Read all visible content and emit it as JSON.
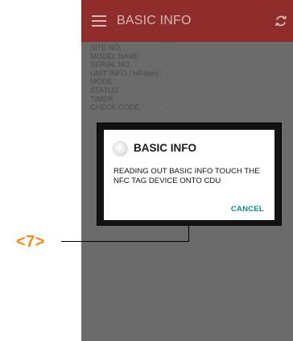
{
  "appbar": {
    "title": "BASIC INFO",
    "menu_icon": "hamburger-menu-icon",
    "refresh_icon": "refresh-icon"
  },
  "info_rows": [
    {
      "label": "SITE NO.",
      "value": "-"
    },
    {
      "label": "MODEL NAME",
      "value": "-"
    },
    {
      "label": "SERIAL NO.",
      "value": "-"
    },
    {
      "label": "UNIT INFO / HP(ton)",
      "value": "-"
    },
    {
      "label": "MODE",
      "value": "-"
    },
    {
      "label": "STATUS",
      "value": "-"
    },
    {
      "label": "TIMER",
      "value": "-"
    },
    {
      "label": "CHECK CODE",
      "value": "-"
    }
  ],
  "dialog": {
    "title": "BASIC INFO",
    "message": "READING OUT BASIC INFO TOUCH THE NFC TAG DEVICE ONTO CDU",
    "cancel_label": "CANCEL",
    "icon": "nfc-reading-icon"
  },
  "callout": {
    "label": "<7>",
    "color": "#f48a1e"
  },
  "colors": {
    "appbar": "#8e2d2b",
    "cancel": "#0f8d7a"
  }
}
